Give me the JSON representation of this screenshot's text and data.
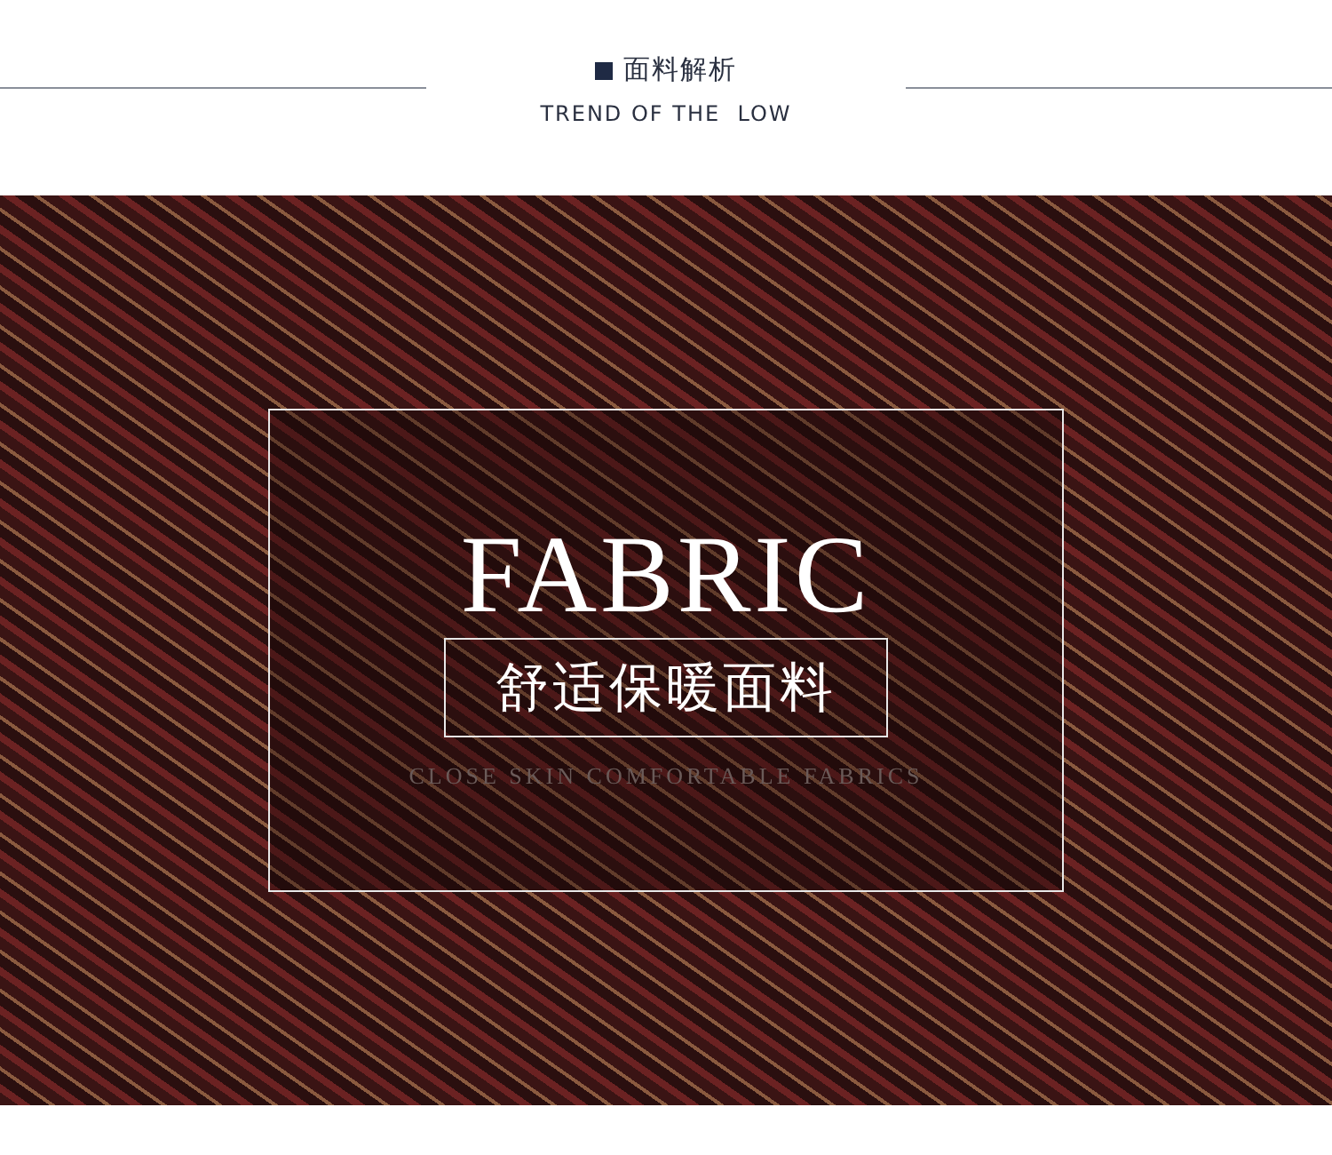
{
  "header": {
    "title": "面料解析",
    "subtitle": "TREND OF THE  LOW"
  },
  "banner": {
    "heading": "FABRIC",
    "caption": "舒适保暖面料",
    "tagline": "CLOSE SKIN COMFORTABLE FABRICS"
  }
}
